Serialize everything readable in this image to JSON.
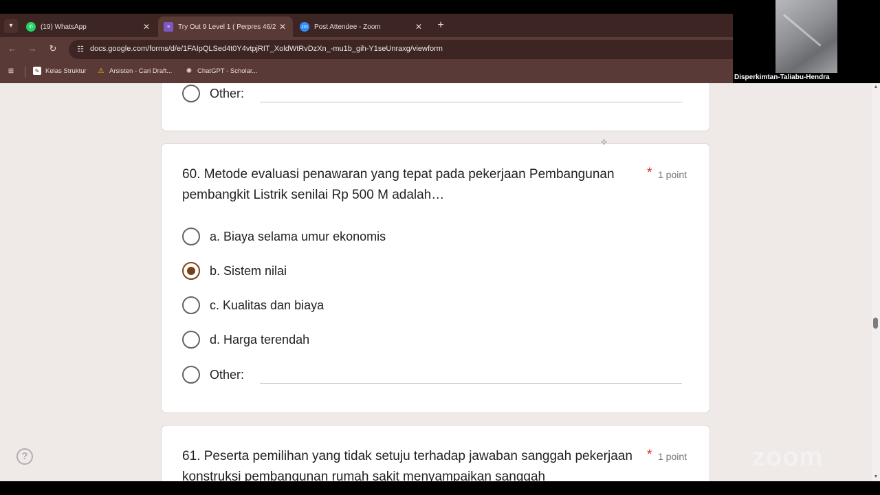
{
  "tabs": [
    {
      "label": "(19) WhatsApp",
      "icon": "whatsapp-icon",
      "active": false
    },
    {
      "label": "Try Out 9 Level 1 ( Perpres 46/2",
      "icon": "google-forms-icon",
      "active": true
    },
    {
      "label": "Post Attendee - Zoom",
      "icon": "zoom-icon",
      "active": false
    }
  ],
  "toolbar": {
    "url": "docs.google.com/forms/d/e/1FAIpQLSed4t0Y4vtpjRIT_XoldWtRvDzXn_-mu1b_gih-Y1seUnraxg/viewform"
  },
  "bookmarks": [
    {
      "label": "Kelas Struktur",
      "icon": "bookmark-page-icon"
    },
    {
      "label": "Arsisten - Cari Draft...",
      "icon": "warning-triangle-icon"
    },
    {
      "label": "ChatGPT - Scholar...",
      "icon": "openai-icon"
    }
  ],
  "video": {
    "participant_name": "Disperkimtan-Taliabu-Hendra"
  },
  "prev_question": {
    "other_label": "Other:"
  },
  "question60": {
    "title": "60.  Metode evaluasi penawaran yang tepat pada pekerjaan Pembangunan pembangkit Listrik senilai Rp 500 M adalah…",
    "required_mark": "*",
    "points": "1 point",
    "options": [
      {
        "label": "a. Biaya selama umur ekonomis",
        "selected": false
      },
      {
        "label": "b. Sistem nilai",
        "selected": true
      },
      {
        "label": "c. Kualitas dan biaya",
        "selected": false
      },
      {
        "label": "d. Harga terendah",
        "selected": false
      }
    ],
    "other_label": "Other:"
  },
  "question61": {
    "title": "61. Peserta pemilihan yang tidak setuju terhadap  jawaban sanggah pekerjaan konstruksi pembangunan rumah sakit menyampaikan sanggah",
    "required_mark": "*",
    "points": "1 point"
  },
  "overlay": {
    "zoom_watermark": "zoom",
    "help": "?"
  },
  "colors": {
    "accent": "#7b3f12",
    "required": "#d93025",
    "page_bg": "#efe9e8",
    "chrome": "#5a3a37"
  }
}
